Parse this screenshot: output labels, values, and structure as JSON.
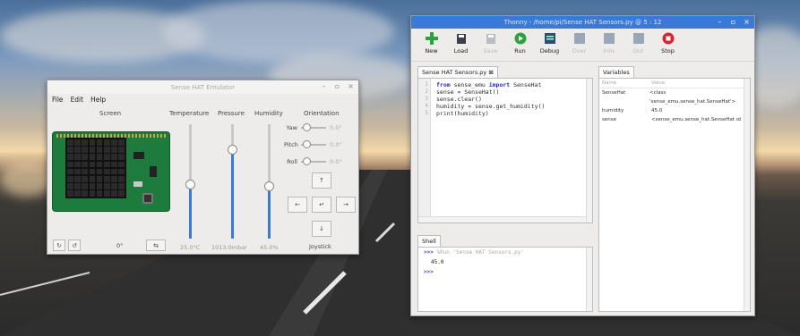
{
  "sense_emulator": {
    "title": "Sense HAT Emulator",
    "menu": [
      "File",
      "Edit",
      "Help"
    ],
    "screen_label": "Screen",
    "rotation_value": "0°",
    "sensors": [
      {
        "label": "Temperature",
        "value": "25.0°C",
        "level": 0.48
      },
      {
        "label": "Pressure",
        "value": "1013.0mbar",
        "level": 0.78
      },
      {
        "label": "Humidity",
        "value": "45.0%",
        "level": 0.46
      }
    ],
    "orientation": {
      "label": "Orientation",
      "rows": [
        {
          "label": "Yaw",
          "value": "0.0°"
        },
        {
          "label": "Pitch",
          "value": "0.0°"
        },
        {
          "label": "Roll",
          "value": "0.0°"
        }
      ]
    },
    "joystick_label": "Joystick",
    "window_buttons": [
      "–",
      "▫",
      "×"
    ]
  },
  "thonny": {
    "title": "Thonny  -  /home/pi/Sense HAT Sensors.py  @  5 : 12",
    "window_buttons": [
      "–",
      "▫",
      "×"
    ],
    "toolbar": [
      {
        "label": "New",
        "icon": "new-icon",
        "enabled": true
      },
      {
        "label": "Load",
        "icon": "load-icon",
        "enabled": true
      },
      {
        "label": "Save",
        "icon": "save-icon",
        "enabled": false
      },
      {
        "label": "Run",
        "icon": "run-icon",
        "enabled": true
      },
      {
        "label": "Debug",
        "icon": "debug-icon",
        "enabled": true
      },
      {
        "label": "Over",
        "icon": "step-over-icon",
        "enabled": false
      },
      {
        "label": "Into",
        "icon": "step-into-icon",
        "enabled": false
      },
      {
        "label": "Out",
        "icon": "step-out-icon",
        "enabled": false
      },
      {
        "label": "Stop",
        "icon": "stop-icon",
        "enabled": true
      }
    ],
    "editor_tab": "Sense HAT Sensors.py ⊠",
    "line_numbers": [
      "1",
      "2",
      "3",
      "4",
      "5"
    ],
    "code": [
      {
        "kw1": "from",
        "mid": " sense_emu ",
        "kw2": "import",
        "rest": " SenseHat"
      },
      {
        "kw1": "",
        "mid": "sense = SenseHat()",
        "kw2": "",
        "rest": ""
      },
      {
        "kw1": "",
        "mid": "sense.clear()",
        "kw2": "",
        "rest": ""
      },
      {
        "kw1": "",
        "mid": "humidity = sense.get_humidity()",
        "kw2": "",
        "rest": ""
      },
      {
        "kw1": "",
        "mid": "print(humidity)",
        "kw2": "",
        "rest": ""
      }
    ],
    "variables_tab": "Variables",
    "variables_headers": [
      "Name",
      "Value"
    ],
    "variables": [
      {
        "name": "SenseHat",
        "value": "<class 'sense_emu.sense_hat.SenseHat'>"
      },
      {
        "name": "humidity",
        "value": "45.0"
      },
      {
        "name": "sense",
        "value": "<sense_emu.sense_hat.SenseHat object"
      }
    ],
    "shell_tab": "Shell",
    "shell": {
      "prompt": ">>>",
      "command": "%Run 'Sense HAT Sensors.py'",
      "output": "45.0"
    }
  }
}
